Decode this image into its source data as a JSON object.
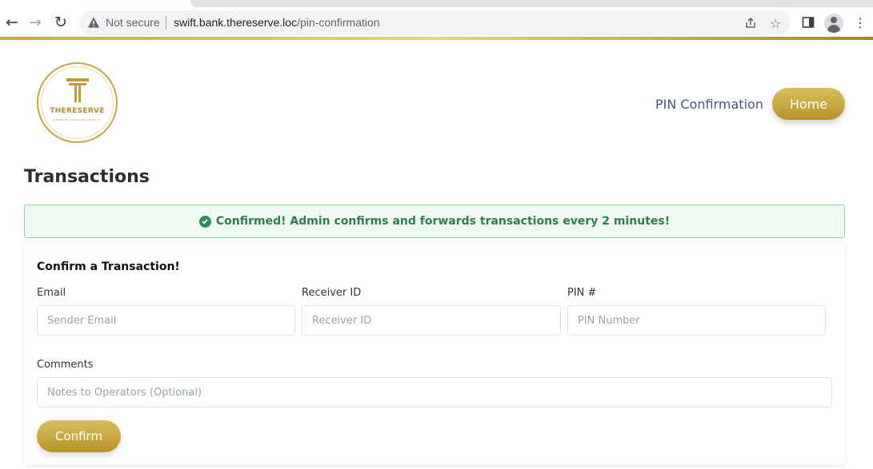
{
  "browser": {
    "security_text": "Not secure",
    "url_host": "swift.bank.thereserve.loc",
    "url_path": "/pin-confirmation"
  },
  "logo": {
    "name": "THERESERVE",
    "tagline": "STRENGTH THROUGH STABILITY"
  },
  "nav": {
    "link_label": "PIN Confirmation",
    "home_label": "Home"
  },
  "page": {
    "title": "Transactions"
  },
  "alert": {
    "message": "Confirmed! Admin confirms and forwards transactions every 2 minutes!",
    "color": "#2e7d4f"
  },
  "form": {
    "title": "Confirm a Transaction!",
    "email": {
      "label": "Email",
      "placeholder": "Sender Email",
      "value": ""
    },
    "receiver": {
      "label": "Receiver ID",
      "placeholder": "Receiver ID",
      "value": ""
    },
    "pin": {
      "label": "PIN #",
      "placeholder": "PIN Number",
      "value": ""
    },
    "comments": {
      "label": "Comments",
      "placeholder": "Notes to Operators (Optional)",
      "value": ""
    },
    "submit_label": "Confirm"
  },
  "colors": {
    "accent_gold": "#c9a548",
    "link": "#3d5a7a"
  }
}
